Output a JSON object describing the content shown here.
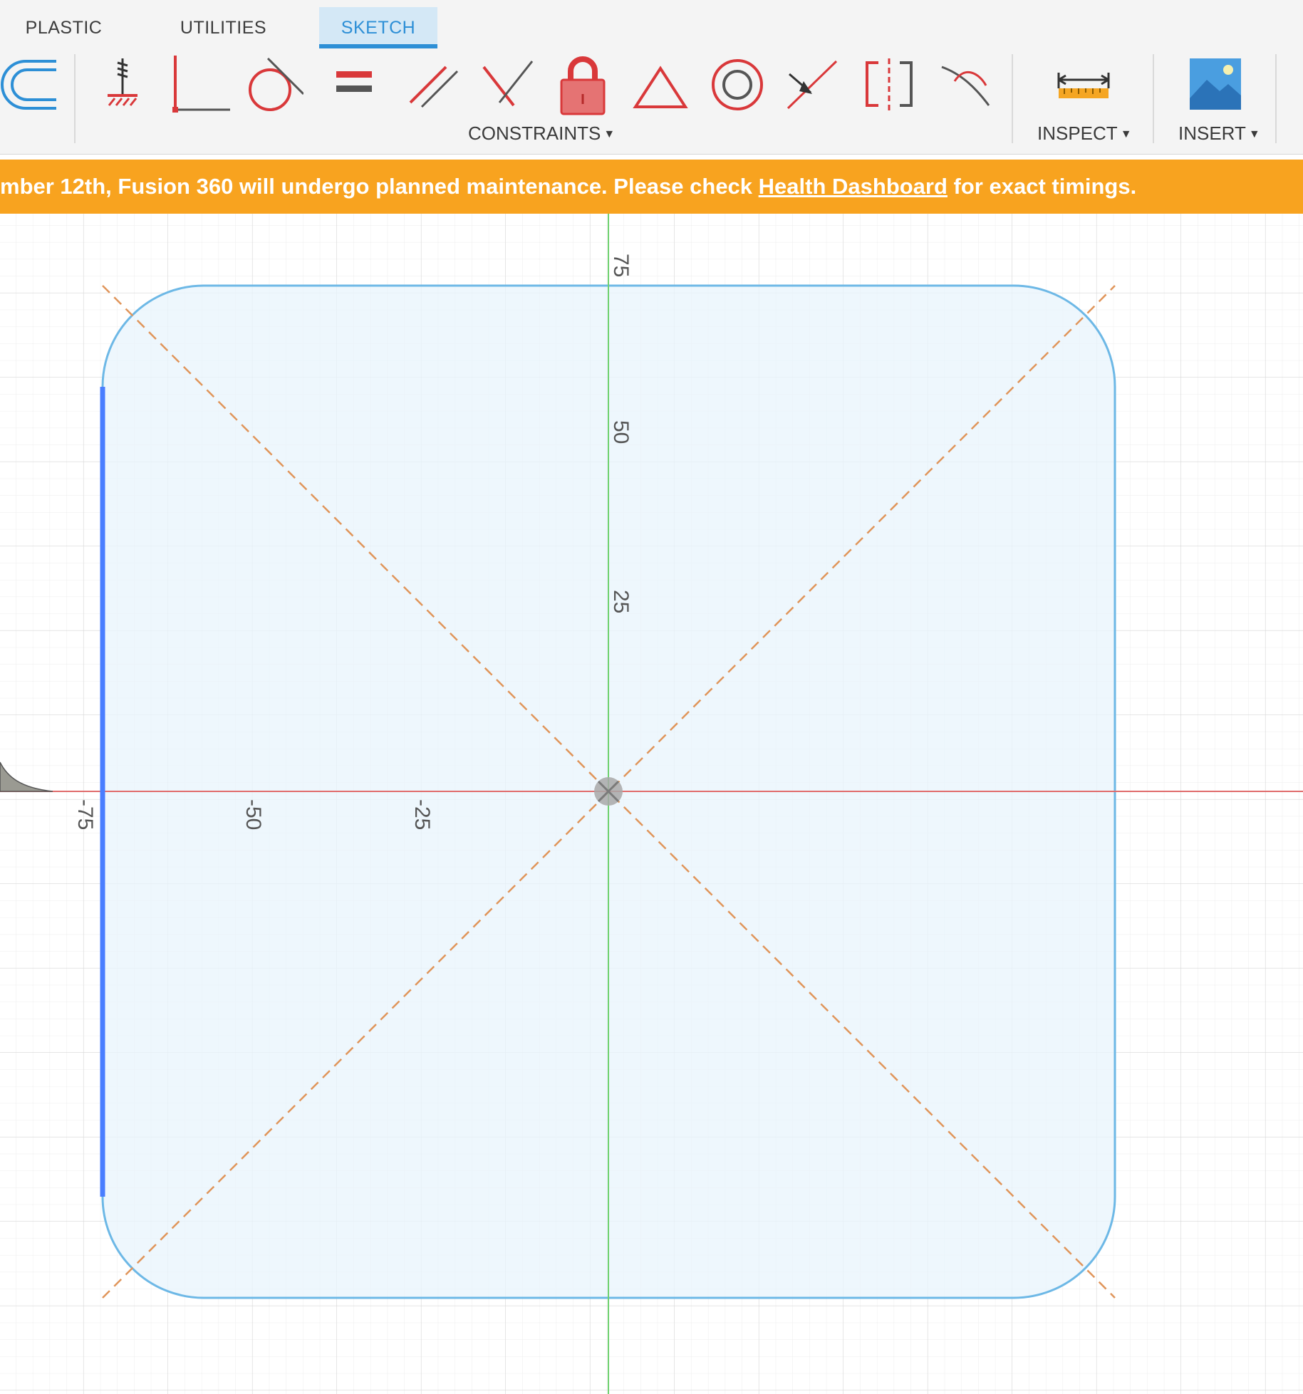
{
  "tabs": [
    {
      "label": "PLASTIC",
      "active": false
    },
    {
      "label": "UTILITIES",
      "active": false
    },
    {
      "label": "SKETCH",
      "active": true
    }
  ],
  "toolbar": {
    "tools": [
      {
        "name": "offset-icon"
      },
      {
        "name": "fix-unfix-icon"
      },
      {
        "name": "coincident-icon"
      },
      {
        "name": "tangent-icon"
      },
      {
        "name": "equal-icon"
      },
      {
        "name": "parallel-icon"
      },
      {
        "name": "perpendicular-icon"
      },
      {
        "name": "lock-icon"
      },
      {
        "name": "triangle-icon"
      },
      {
        "name": "concentric-icon"
      },
      {
        "name": "midpoint-icon"
      },
      {
        "name": "symmetry-icon"
      },
      {
        "name": "curvature-icon"
      },
      {
        "name": "measure-icon"
      },
      {
        "name": "insert-image-icon"
      }
    ],
    "groups": {
      "constraints": "CONSTRAINTS",
      "inspect": "INSPECT",
      "insert": "INSERT"
    }
  },
  "banner": {
    "text_before": "mber 12th, Fusion 360 will undergo planned maintenance. Please check ",
    "link": "Health Dashboard",
    "text_after": " for exact timings.",
    "color": "#f8a31f"
  },
  "canvas": {
    "x_ticks": [
      "-75",
      "-50",
      "-25"
    ],
    "y_ticks": [
      "75",
      "50",
      "25"
    ],
    "colors": {
      "profile_fill": "#e8f4fc",
      "profile_stroke": "#6db8e6",
      "selected_edge": "#4a7eff",
      "construction": "#e0955a",
      "x_axis": "#e06b6b",
      "y_axis": "#6fd16f"
    }
  }
}
